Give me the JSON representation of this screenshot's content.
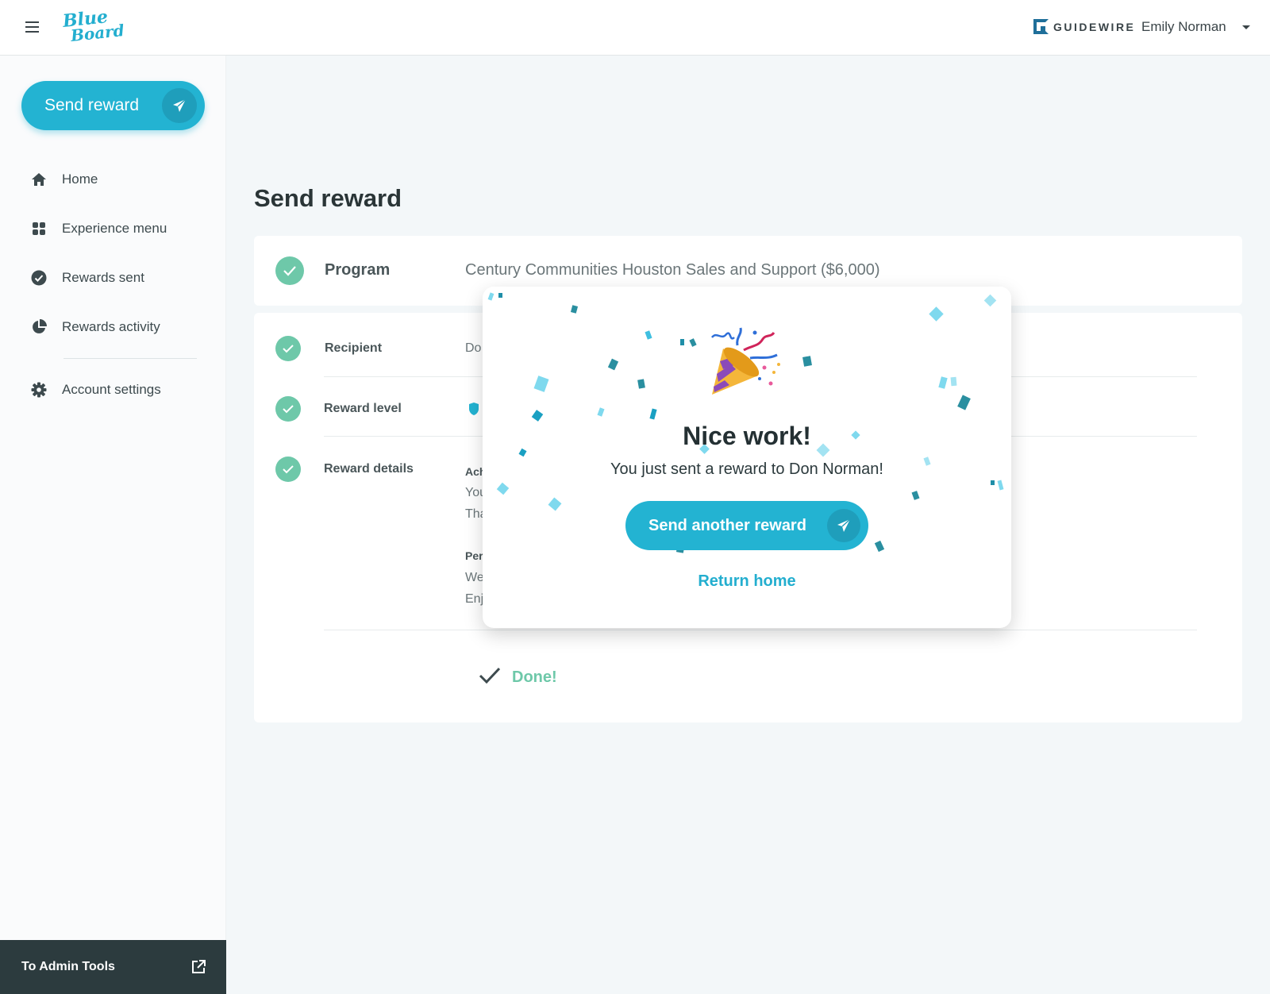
{
  "header": {
    "logo_text_1": "Blue",
    "logo_text_2": "Board",
    "company_logo": "GUIDEWIRE",
    "user_name": "Emily Norman"
  },
  "sidebar": {
    "send_button": "Send reward",
    "items": [
      {
        "label": "Home",
        "icon": "home-icon"
      },
      {
        "label": "Experience menu",
        "icon": "grid-icon"
      },
      {
        "label": "Rewards sent",
        "icon": "check-circle-icon"
      },
      {
        "label": "Rewards activity",
        "icon": "pie-chart-icon"
      },
      {
        "label": "Account settings",
        "icon": "gear-icon"
      }
    ],
    "admin_link": "To Admin Tools"
  },
  "main": {
    "title": "Send reward",
    "program": {
      "label": "Program",
      "value": "Century Communities Houston Sales and Support ($6,000)"
    },
    "steps": [
      {
        "label": "Recipient",
        "value": "Do"
      },
      {
        "label": "Reward level",
        "value": ""
      },
      {
        "label": "Reward details",
        "value": ""
      }
    ],
    "details_fragments": [
      "Ach",
      "You",
      "Tha",
      "Per",
      "We",
      "Enj"
    ],
    "done": "Done!"
  },
  "modal": {
    "title": "Nice work!",
    "message": "You just sent a reward to Don Norman!",
    "primary_button": "Send another reward",
    "secondary_link": "Return home"
  },
  "colors": {
    "accent": "#23b3d2",
    "accent_dark": "#1f9ebb",
    "success": "#6ec8a9",
    "sidebar_footer": "#2c3b3e"
  }
}
